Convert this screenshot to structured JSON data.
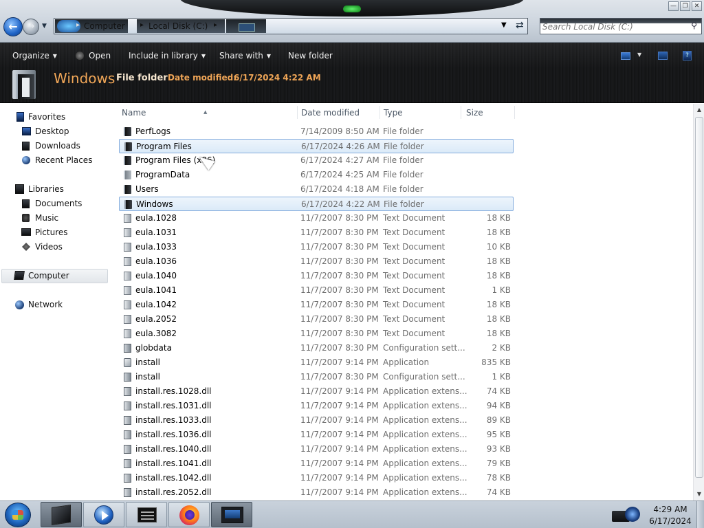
{
  "window": {
    "breadcrumbs": [
      "Computer",
      "Local Disk (C:)"
    ],
    "search_placeholder": "Search Local Disk (C:)",
    "controls": {
      "minimize": "—",
      "maximize": "❐",
      "close": "✕"
    }
  },
  "toolbar": {
    "organize": "Organize",
    "open": "Open",
    "include_in_library": "Include in library",
    "share_with": "Share with",
    "new_folder": "New folder"
  },
  "details": {
    "name": "Windows",
    "type": "File folder",
    "date_label": "Date modified:",
    "date_value": "6/17/2024 4:22 AM"
  },
  "nav": {
    "favorites": "Favorites",
    "desktop": "Desktop",
    "downloads": "Downloads",
    "recent_places": "Recent Places",
    "libraries": "Libraries",
    "documents": "Documents",
    "music": "Music",
    "pictures": "Pictures",
    "videos": "Videos",
    "computer": "Computer",
    "network": "Network"
  },
  "columns": {
    "name": "Name",
    "date": "Date modified",
    "type": "Type",
    "size": "Size"
  },
  "files": [
    {
      "name": "PerfLogs",
      "date": "7/14/2009 8:50 AM",
      "type": "File folder",
      "size": "",
      "icon": "folder-icon"
    },
    {
      "name": "Program Files",
      "date": "6/17/2024 4:26 AM",
      "type": "File folder",
      "size": "",
      "icon": "folder-icon"
    },
    {
      "name": "Program Files (x86)",
      "date": "6/17/2024 4:27 AM",
      "type": "File folder",
      "size": "",
      "icon": "folder-icon"
    },
    {
      "name": "ProgramData",
      "date": "6/17/2024 4:25 AM",
      "type": "File folder",
      "size": "",
      "icon": "hidden-folder-icon"
    },
    {
      "name": "Users",
      "date": "6/17/2024 4:18 AM",
      "type": "File folder",
      "size": "",
      "icon": "folder-icon"
    },
    {
      "name": "Windows",
      "date": "6/17/2024 4:22 AM",
      "type": "File folder",
      "size": "",
      "icon": "folder-icon"
    },
    {
      "name": "eula.1028",
      "date": "11/7/2007 8:30 PM",
      "type": "Text Document",
      "size": "18 KB",
      "icon": "text-document-icon"
    },
    {
      "name": "eula.1031",
      "date": "11/7/2007 8:30 PM",
      "type": "Text Document",
      "size": "18 KB",
      "icon": "text-document-icon"
    },
    {
      "name": "eula.1033",
      "date": "11/7/2007 8:30 PM",
      "type": "Text Document",
      "size": "10 KB",
      "icon": "text-document-icon"
    },
    {
      "name": "eula.1036",
      "date": "11/7/2007 8:30 PM",
      "type": "Text Document",
      "size": "18 KB",
      "icon": "text-document-icon"
    },
    {
      "name": "eula.1040",
      "date": "11/7/2007 8:30 PM",
      "type": "Text Document",
      "size": "18 KB",
      "icon": "text-document-icon"
    },
    {
      "name": "eula.1041",
      "date": "11/7/2007 8:30 PM",
      "type": "Text Document",
      "size": "1 KB",
      "icon": "text-document-icon"
    },
    {
      "name": "eula.1042",
      "date": "11/7/2007 8:30 PM",
      "type": "Text Document",
      "size": "18 KB",
      "icon": "text-document-icon"
    },
    {
      "name": "eula.2052",
      "date": "11/7/2007 8:30 PM",
      "type": "Text Document",
      "size": "18 KB",
      "icon": "text-document-icon"
    },
    {
      "name": "eula.3082",
      "date": "11/7/2007 8:30 PM",
      "type": "Text Document",
      "size": "18 KB",
      "icon": "text-document-icon"
    },
    {
      "name": "globdata",
      "date": "11/7/2007 8:30 PM",
      "type": "Configuration sett...",
      "size": "2 KB",
      "icon": "config-file-icon"
    },
    {
      "name": "install",
      "date": "11/7/2007 9:14 PM",
      "type": "Application",
      "size": "835 KB",
      "icon": "application-icon"
    },
    {
      "name": "install",
      "date": "11/7/2007 8:30 PM",
      "type": "Configuration sett...",
      "size": "1 KB",
      "icon": "config-file-icon"
    },
    {
      "name": "install.res.1028.dll",
      "date": "11/7/2007 9:14 PM",
      "type": "Application extens...",
      "size": "74 KB",
      "icon": "dll-file-icon"
    },
    {
      "name": "install.res.1031.dll",
      "date": "11/7/2007 9:14 PM",
      "type": "Application extens...",
      "size": "94 KB",
      "icon": "dll-file-icon"
    },
    {
      "name": "install.res.1033.dll",
      "date": "11/7/2007 9:14 PM",
      "type": "Application extens...",
      "size": "89 KB",
      "icon": "dll-file-icon"
    },
    {
      "name": "install.res.1036.dll",
      "date": "11/7/2007 9:14 PM",
      "type": "Application extens...",
      "size": "95 KB",
      "icon": "dll-file-icon"
    },
    {
      "name": "install.res.1040.dll",
      "date": "11/7/2007 9:14 PM",
      "type": "Application extens...",
      "size": "93 KB",
      "icon": "dll-file-icon"
    },
    {
      "name": "install.res.1041.dll",
      "date": "11/7/2007 9:14 PM",
      "type": "Application extens...",
      "size": "79 KB",
      "icon": "dll-file-icon"
    },
    {
      "name": "install.res.1042.dll",
      "date": "11/7/2007 9:14 PM",
      "type": "Application extens...",
      "size": "78 KB",
      "icon": "dll-file-icon"
    },
    {
      "name": "install.res.2052.dll",
      "date": "11/7/2007 9:14 PM",
      "type": "Application extens...",
      "size": "74 KB",
      "icon": "dll-file-icon"
    }
  ],
  "selected_rows": [
    1,
    5
  ],
  "taskbar": {
    "items": [
      "explorer-icon",
      "media-player-icon",
      "command-prompt-icon",
      "firefox-icon",
      "display-icon"
    ],
    "clock_time": "4:29 AM",
    "clock_date": "6/17/2024"
  },
  "colors": {
    "details_accent": "#f0a657",
    "selection_border": "#84acdd",
    "command_bar": "#161718"
  }
}
